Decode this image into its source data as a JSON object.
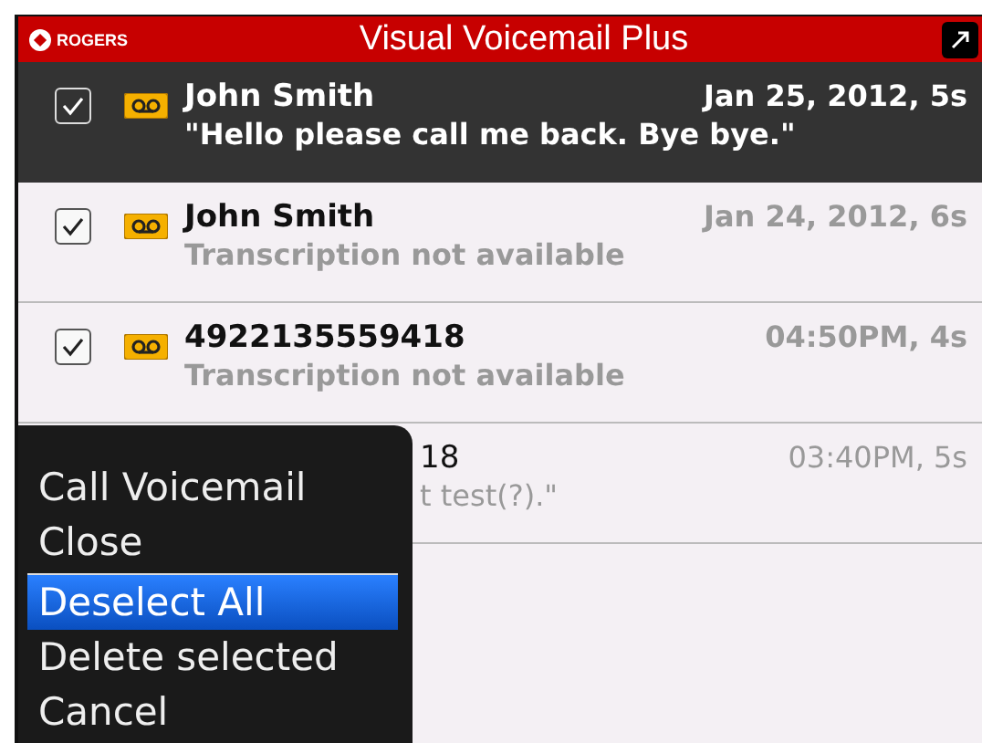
{
  "header": {
    "carrier": "ROGERS",
    "title": "Visual Voicemail Plus"
  },
  "messages": [
    {
      "kind": "full",
      "checked": true,
      "focused": true,
      "unread": true,
      "name": "John Smith",
      "date": "Jan 25, 2012, 5s",
      "transcript": "\"Hello please call me back. Bye bye.\""
    },
    {
      "kind": "full",
      "checked": true,
      "focused": false,
      "unread": true,
      "name": "John Smith",
      "date": "Jan 24, 2012, 6s",
      "transcript": "Transcription not available"
    },
    {
      "kind": "full",
      "checked": true,
      "focused": false,
      "unread": true,
      "name": "4922135559418",
      "date": "04:50PM, 4s",
      "transcript": "Transcription not available"
    },
    {
      "kind": "partial",
      "focused": false,
      "unread": false,
      "name": "18",
      "date": "03:40PM, 5s",
      "transcript": "t test(?).\""
    }
  ],
  "menu": [
    {
      "label": "Call Voicemail",
      "selected": false,
      "divider_before": false
    },
    {
      "label": "Close",
      "selected": false,
      "divider_before": false
    },
    {
      "label": "Deselect All",
      "selected": true,
      "divider_before": true
    },
    {
      "label": "Delete selected",
      "selected": false,
      "divider_before": false
    },
    {
      "label": "Cancel",
      "selected": false,
      "divider_before": false
    }
  ]
}
